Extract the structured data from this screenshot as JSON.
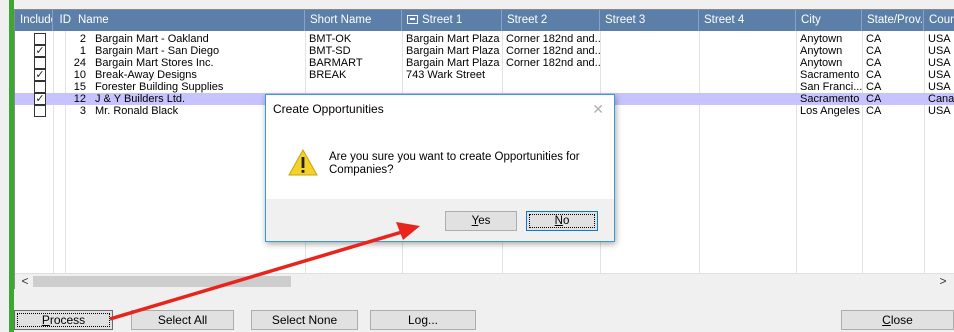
{
  "grid": {
    "columns": [
      {
        "key": "include",
        "label": "Include"
      },
      {
        "key": "id",
        "label": "ID"
      },
      {
        "key": "name",
        "label": "Name"
      },
      {
        "key": "short",
        "label": "Short Name"
      },
      {
        "key": "street1",
        "label": "Street 1",
        "icon": "address-card-icon"
      },
      {
        "key": "street2",
        "label": "Street 2"
      },
      {
        "key": "street3",
        "label": "Street 3"
      },
      {
        "key": "street4",
        "label": "Street 4"
      },
      {
        "key": "city",
        "label": "City"
      },
      {
        "key": "state",
        "label": "State/Prov."
      },
      {
        "key": "country",
        "label": "Coun"
      }
    ],
    "rows": [
      {
        "checked": false,
        "selected": false,
        "id": "2",
        "name": "Bargain Mart - Oakland",
        "short": "BMT-OK",
        "street1": "Bargain Mart Plaza",
        "street2": "Corner 182nd and...",
        "city": "Anytown",
        "state": "CA",
        "country": "USA"
      },
      {
        "checked": true,
        "selected": false,
        "id": "1",
        "name": "Bargain Mart - San Diego",
        "short": "BMT-SD",
        "street1": "Bargain Mart Plaza",
        "street2": "Corner 182nd and...",
        "city": "Anytown",
        "state": "CA",
        "country": "USA"
      },
      {
        "checked": false,
        "selected": false,
        "id": "24",
        "name": "Bargain Mart Stores Inc.",
        "short": "BARMART",
        "street1": "Bargain Mart Plaza",
        "street2": "Corner 182nd and...",
        "city": "Anytown",
        "state": "CA",
        "country": "USA"
      },
      {
        "checked": true,
        "selected": false,
        "id": "10",
        "name": "Break-Away Designs",
        "short": "BREAK",
        "street1": "743 Wark Street",
        "street2": "",
        "city": "Sacramento",
        "state": "CA",
        "country": "USA"
      },
      {
        "checked": false,
        "selected": false,
        "id": "15",
        "name": "Forester Building Supplies",
        "short": "",
        "street1": "",
        "street2": "",
        "city": "San Franci...",
        "state": "CA",
        "country": "USA"
      },
      {
        "checked": true,
        "selected": true,
        "id": "12",
        "name": "J & Y Builders Ltd.",
        "short": "",
        "street1": "",
        "street2": "",
        "city": "Sacramento",
        "state": "CA",
        "country": "Canad"
      },
      {
        "checked": false,
        "selected": false,
        "id": "3",
        "name": "Mr. Ronald Black",
        "short": "",
        "street1": "",
        "street2": "",
        "city": "Los Angeles",
        "state": "CA",
        "country": "USA"
      }
    ],
    "scroll_left": "<",
    "scroll_right": ">"
  },
  "buttons": {
    "process": "Process",
    "select_all": "Select All",
    "select_none": "Select None",
    "log": "Log...",
    "close": "Close"
  },
  "dialog": {
    "title": "Create Opportunities",
    "close_glyph": "✕",
    "icon": "warning-icon",
    "message": "Are you sure you want to create Opportunities for Companies?",
    "yes": "Yes",
    "no": "No"
  },
  "colors": {
    "header": "#5b7fa8",
    "selected_row": "#c6c3ff",
    "accent_bar": "#3fa535",
    "annotation_arrow": "#e8241c"
  }
}
